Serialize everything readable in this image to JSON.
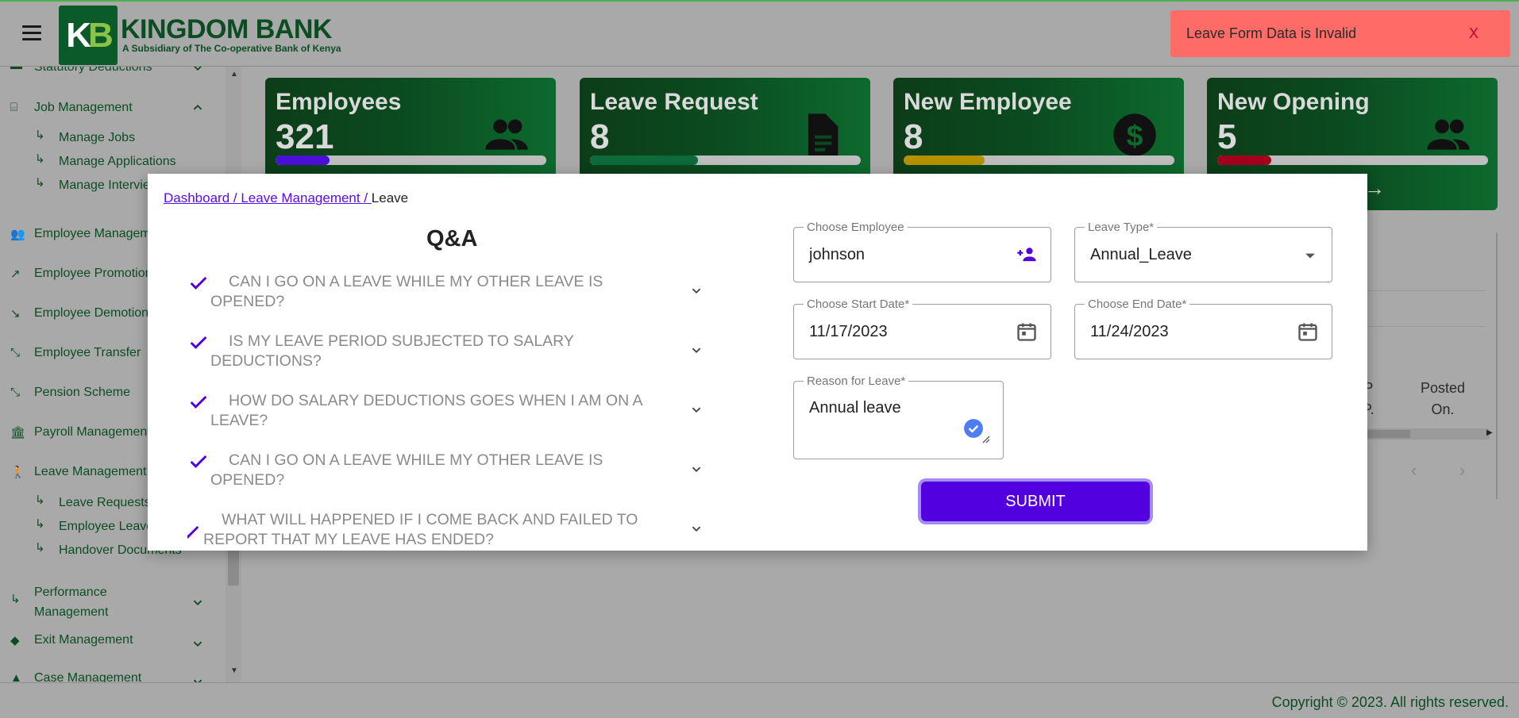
{
  "header": {
    "brand_logo_text_k": "K",
    "brand_logo_text_b": "B",
    "brand_name": "KINGDOM BANK",
    "brand_subtitle": "A Subsidiary of The Co-operative Bank of Kenya"
  },
  "toast": {
    "message": "Leave Form Data is Invalid",
    "close_label": "X",
    "color": "#ff6b66"
  },
  "sidebar": {
    "items": [
      {
        "label": "Statutory Deductions",
        "icon": "deductions-icon",
        "expanded": false
      },
      {
        "label": "Job Management",
        "icon": "job-icon",
        "expanded": true
      },
      {
        "label": "Manage Jobs"
      },
      {
        "label": "Manage Applications"
      },
      {
        "label": "Manage Interviews"
      },
      {
        "label": "Employee Management",
        "icon": "people-icon"
      },
      {
        "label": "Employee Promotion",
        "icon": "trending-up-icon"
      },
      {
        "label": "Employee Demotion",
        "icon": "trending-down-icon"
      },
      {
        "label": "Employee Transfer",
        "icon": "transfer-icon"
      },
      {
        "label": "Pension Scheme",
        "icon": "pension-icon"
      },
      {
        "label": "Payroll Management",
        "icon": "bank-icon"
      },
      {
        "label": "Leave Management",
        "icon": "walk-icon"
      },
      {
        "label": "Leave Requests"
      },
      {
        "label": "Employee Leave"
      },
      {
        "label": "Handover Documents"
      },
      {
        "label": "Performance Management",
        "icon": "arrow-icon",
        "expanded": false
      },
      {
        "label": "Exit Management",
        "icon": "exit-icon",
        "expanded": false
      },
      {
        "label": "Case Management",
        "icon": "warning-icon",
        "expanded": false
      }
    ]
  },
  "cards": [
    {
      "title": "Employees",
      "value": "321",
      "icon": "people-icon",
      "progress": 0.2,
      "color": "#4a10d8"
    },
    {
      "title": "Leave Request",
      "value": "8",
      "icon": "document-icon",
      "progress": 0.4,
      "color": "#0d6a3a"
    },
    {
      "title": "New Employee",
      "value": "8",
      "icon": "dollar-icon",
      "progress": 0.3,
      "color": "#b39100"
    },
    {
      "title": "New Opening",
      "value": "5",
      "icon": "people-icon",
      "progress": 0.2,
      "color": "#a3001e"
    }
  ],
  "background_table": {
    "col_p_line1": "P",
    "col_p_line2": "P.",
    "col_posted_line1": "Posted",
    "col_posted_line2": "On."
  },
  "modal": {
    "breadcrumb": {
      "dashboard": "Dashboard / ",
      "leave_management": "Leave Management / ",
      "current": "Leave"
    },
    "qa_title": "Q&A",
    "faqs": [
      {
        "question": "CAN I GO ON A LEAVE WHILE MY OTHER LEAVE IS OPENED?"
      },
      {
        "question": "IS MY LEAVE PERIOD SUBJECTED TO SALARY DEDUCTIONS?"
      },
      {
        "question": "HOW DO SALARY DEDUCTIONS GOES WHEN I AM ON A LEAVE?"
      },
      {
        "question": "CAN I GO ON A LEAVE WHILE MY OTHER LEAVE IS OPENED?"
      },
      {
        "question": "WHAT WILL HAPPENED IF I COME BACK AND FAILED TO REPORT THAT MY LEAVE HAS ENDED?"
      }
    ],
    "form": {
      "employee_label": "Choose Employee",
      "employee_value": "johnson",
      "leave_type_label": "Leave Type*",
      "leave_type_value": "Annual_Leave",
      "start_date_label": "Choose Start Date*",
      "start_date_value": "11/17/2023",
      "end_date_label": "Choose End Date*",
      "end_date_value": "11/24/2023",
      "reason_label": "Reason for Leave*",
      "reason_value": "Annual leave",
      "submit_label": "SUBMIT"
    }
  },
  "footer": {
    "copyright": "Copyright © 2023. All rights reserved."
  },
  "colors": {
    "brand_green": "#0b4d23",
    "accent_purple": "#5200e0",
    "link_purple": "#5a0bf0"
  }
}
